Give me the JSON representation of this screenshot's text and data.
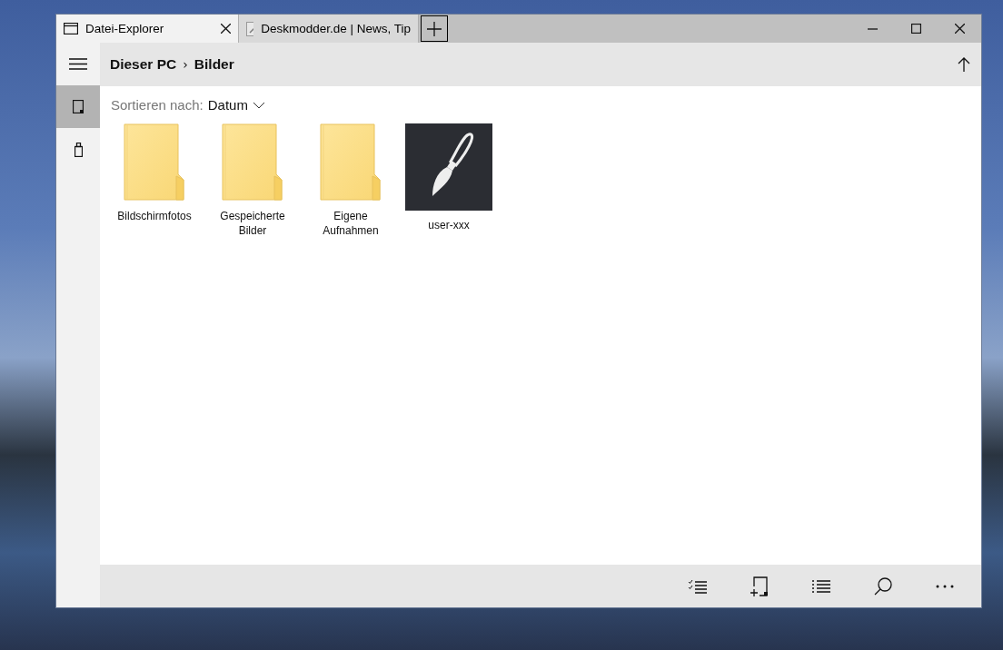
{
  "tabs": [
    {
      "title": "Datei-Explorer",
      "selected": true,
      "kind": "explorer"
    },
    {
      "title": "Deskmodder.de | News, Tip",
      "selected": false,
      "kind": "web"
    }
  ],
  "breadcrumb": {
    "parts": [
      "Dieser PC",
      "Bilder"
    ],
    "separator": "›"
  },
  "sidebar": {
    "items": [
      {
        "kind": "device",
        "selected": true
      },
      {
        "kind": "drive",
        "selected": false
      }
    ]
  },
  "sort": {
    "label": "Sortieren nach:",
    "value": "Datum"
  },
  "items": [
    {
      "name": "Bildschirmfotos",
      "kind": "folder"
    },
    {
      "name": "Gespeicherte Bilder",
      "kind": "folder"
    },
    {
      "name": "Eigene Aufnahmen",
      "kind": "folder"
    },
    {
      "name": "user-xxx",
      "kind": "app"
    }
  ]
}
